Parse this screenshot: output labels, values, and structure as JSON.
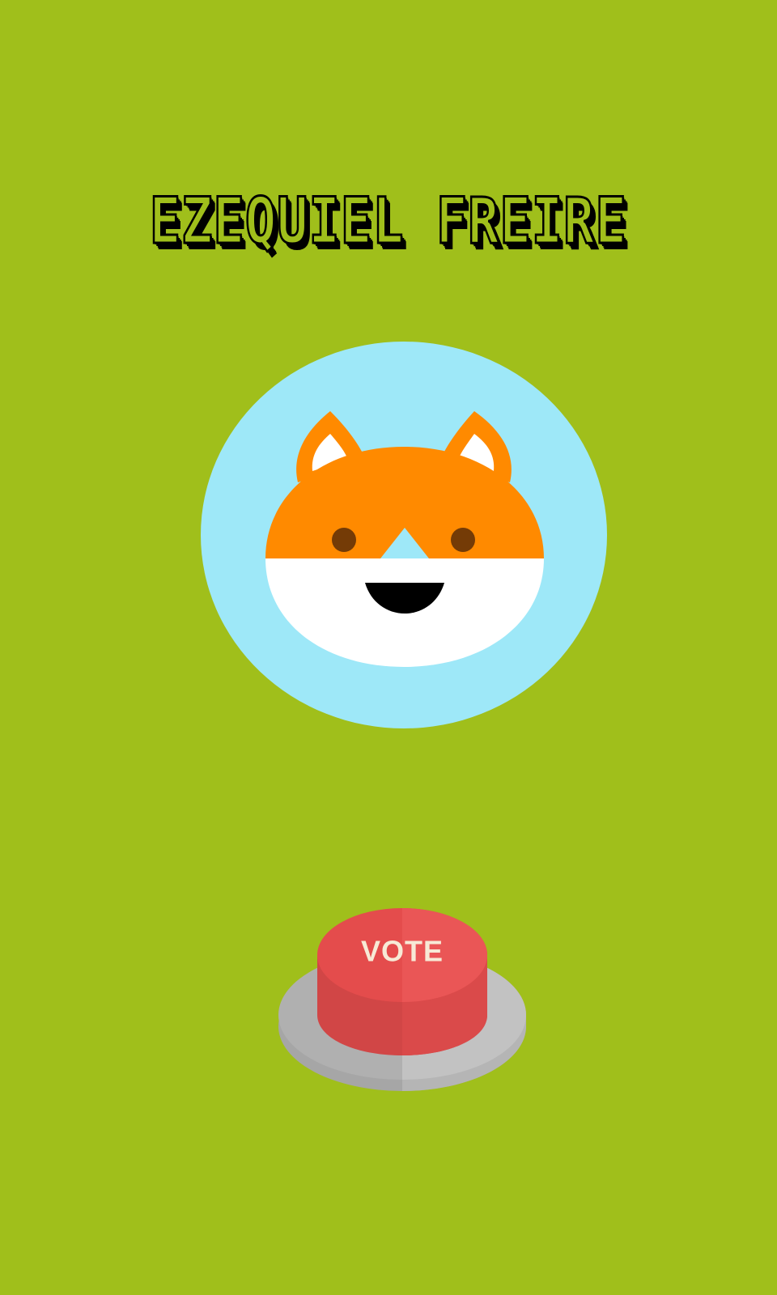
{
  "app": {
    "title": "EZEQUIEL FREIRE"
  },
  "avatar": {
    "icon": "fox-face-icon",
    "colors": {
      "circle": "#9ee8f8",
      "fur": "#ff8a00",
      "face_white": "#ffffff",
      "eye": "#743b06",
      "mouth": "#000000"
    }
  },
  "vote_button": {
    "label": "VOTE",
    "colors": {
      "cap": "#e84f4f",
      "cap_side": "#d74545",
      "base": "#bdbdbd",
      "label": "#f7ead6"
    }
  },
  "theme": {
    "background": "#a0bf1b",
    "title_outline": "#000000"
  }
}
